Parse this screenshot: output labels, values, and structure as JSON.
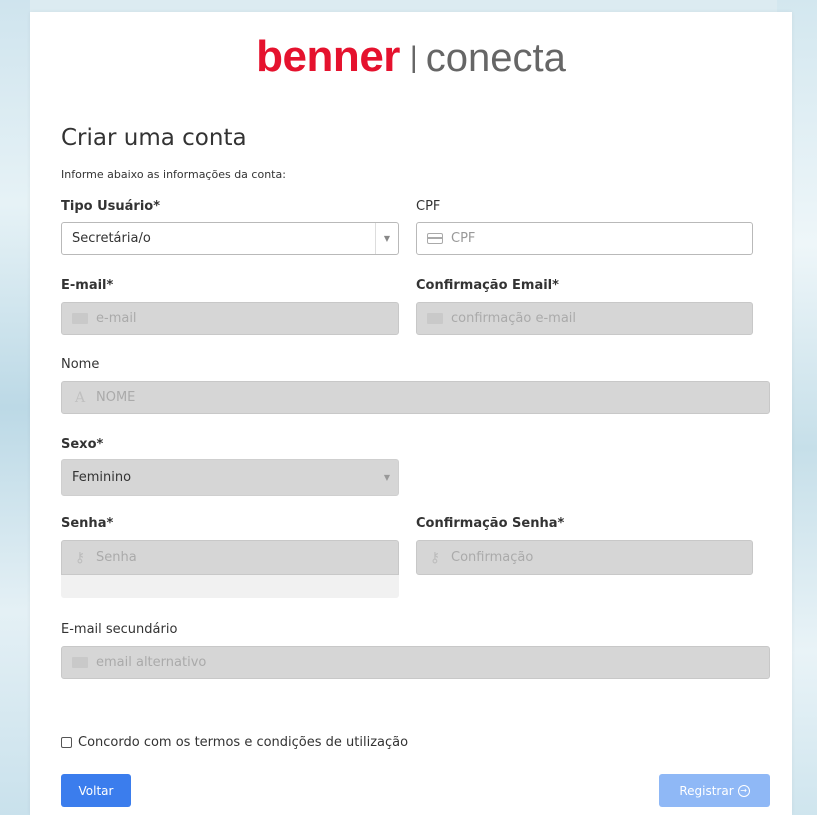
{
  "brand": {
    "name": "benner",
    "separator": "|",
    "product": "conecta",
    "color_brand": "#e5122e"
  },
  "form": {
    "title": "Criar uma conta",
    "subtitle": "Informe abaixo as informações da conta:",
    "tipo_usuario": {
      "label": "Tipo Usuário*",
      "value": "Secretária/o"
    },
    "cpf": {
      "label": "CPF",
      "placeholder": "CPF"
    },
    "email": {
      "label": "E-mail*",
      "placeholder": "e-mail"
    },
    "email_confirm": {
      "label": "Confirmação Email*",
      "placeholder": "confirmação e-mail"
    },
    "nome": {
      "label": "Nome",
      "placeholder": "NOME"
    },
    "sexo": {
      "label": "Sexo*",
      "value": "Feminino"
    },
    "senha": {
      "label": "Senha*",
      "placeholder": "Senha"
    },
    "senha_confirm": {
      "label": "Confirmação Senha*",
      "placeholder": "Confirmação"
    },
    "email_secundario": {
      "label": "E-mail secundário",
      "placeholder": "email alternativo"
    },
    "terms": {
      "label": "Concordo com os termos e condições de utilização",
      "checked": false
    }
  },
  "actions": {
    "back_label": "Voltar",
    "register_label": "Registrar",
    "primary_color": "#3b7ded",
    "disabled_color": "#8fb8f6"
  },
  "icons": {
    "cpf": "card-icon",
    "email": "envelope-icon",
    "nome": "person-icon",
    "senha": "key-icon",
    "register": "arrow-right-circle-icon",
    "select": "chevron-down-icon"
  }
}
